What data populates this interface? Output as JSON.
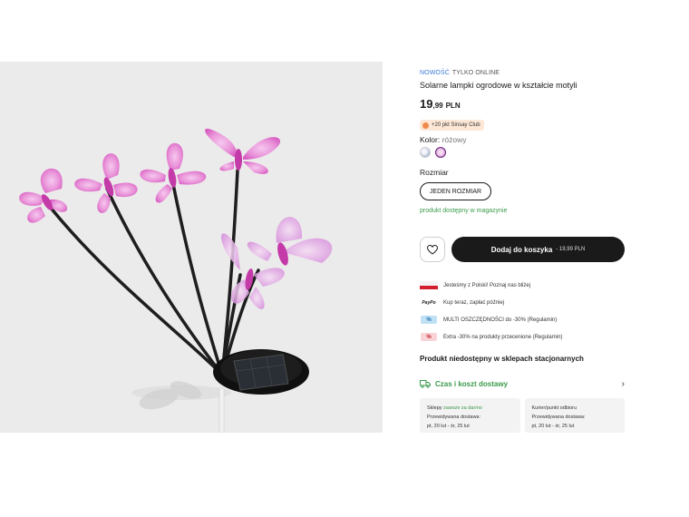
{
  "product": {
    "tag_new": "NOWOŚĆ",
    "tag_online": "TYLKO ONLINE",
    "title": "Solarne lampki ogrodowe w kształcie motyli",
    "price_int": "19",
    "price_dec": ",99",
    "currency": "PLN",
    "club_badge": "+20 pkt Sinsay Club",
    "color_label": "Kolor:",
    "color_value": "różowy",
    "size_label": "Rozmiar",
    "size_option": "JEDEN ROZMIAR",
    "stock_status": "produkt dostępny w magazynie"
  },
  "actions": {
    "add_to_cart": "Dodaj do koszyka",
    "add_to_cart_price": "- 19,99 PLN",
    "favorite_icon": "heart-icon"
  },
  "perks": [
    {
      "icon": "poland-flag-icon",
      "text": "Jesteśmy z Polski! Poznaj nas bliżej"
    },
    {
      "icon": "paypo-logo",
      "logo_text": "PayPo",
      "text": "Kup teraz, zapłać później"
    },
    {
      "icon": "blue-tag-icon",
      "text": "MULTI OSZCZĘDNOŚCI do -30% (Regulamin)"
    },
    {
      "icon": "red-tag-icon",
      "text": "Extra -30% na produkty przecenione (Regulamin)"
    }
  ],
  "store_availability": "Produkt niedostępny w sklepach stacjonarnych",
  "delivery": {
    "label": "Czas i koszt dostawy",
    "options": [
      {
        "name": "Sklepy",
        "note": "zawsze za darmo",
        "eta_label": "Przewidywana dostawa:",
        "eta": "pt, 20 lut - śr, 25 lut"
      },
      {
        "name": "Kurier/punkt odbioru",
        "note": "",
        "eta_label": "Przewidywana dostawa:",
        "eta": "pt, 20 lut - śr, 25 lut"
      }
    ]
  },
  "colors": {
    "accent_green": "#3a9a4a",
    "accent_blue": "#3a7bd5",
    "button_dark": "#1a1a1a",
    "butterfly_pink": "#e05cc4"
  }
}
